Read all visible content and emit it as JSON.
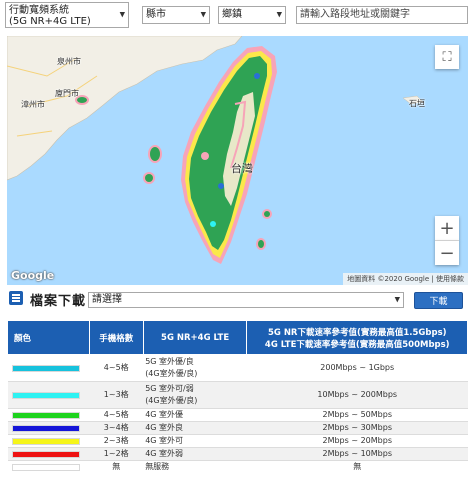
{
  "controls": {
    "system_line1": "行動寬頻系統",
    "system_line2": "(5G NR+4G LTE)",
    "county": "縣市",
    "town": "鄉鎮",
    "address_placeholder": "請輸入路段地址或關鍵字"
  },
  "map": {
    "labels": [
      "泉州市",
      "廈門市",
      "漳州市",
      "台灣",
      "石垣"
    ],
    "google": "Google",
    "attribution": "地圖資料 ©2020 Google | 使用條款",
    "fullscreen_icon": "fullscreen-icon",
    "zoom_in": "+",
    "zoom_out": "−"
  },
  "download": {
    "title": "檔案下載",
    "select_value": "請選擇",
    "button": "下載"
  },
  "legend": {
    "headers": [
      "顏色",
      "手機格數",
      "5G NR+4G LTE",
      "5G NR下載速率參考值(實務最高值1.5Gbps)",
      "4G LTE下載速率參考值(實務最高值500Mbps)"
    ],
    "rows": [
      {
        "color": "#16c2dd",
        "bars": "4~5格",
        "type1": "5G 室外優/良",
        "type2": "(4G室外優/良)",
        "speed": "200Mbps ~ 1Gbps"
      },
      {
        "color": "#2ef2f2",
        "bars": "1~3格",
        "type1": "5G 室外可/弱",
        "type2": "(4G室外優/良)",
        "speed": "10Mbps ~ 200Mbps"
      },
      {
        "color": "#1ed31e",
        "bars": "4~5格",
        "type1": "4G 室外優",
        "type2": "",
        "speed": "2Mbps ~ 50Mbps"
      },
      {
        "color": "#1515d8",
        "bars": "3~4格",
        "type1": "4G 室外良",
        "type2": "",
        "speed": "2Mbps ~ 30Mbps"
      },
      {
        "color": "#f5f51a",
        "bars": "2~3格",
        "type1": "4G 室外可",
        "type2": "",
        "speed": "2Mbps ~ 20Mbps"
      },
      {
        "color": "#ee1212",
        "bars": "1~2格",
        "type1": "4G 室外弱",
        "type2": "",
        "speed": "2Mbps ~ 10Mbps"
      },
      {
        "color": "#ffffff",
        "bars": "無",
        "type1": "無服務",
        "type2": "",
        "speed": "無"
      }
    ]
  }
}
